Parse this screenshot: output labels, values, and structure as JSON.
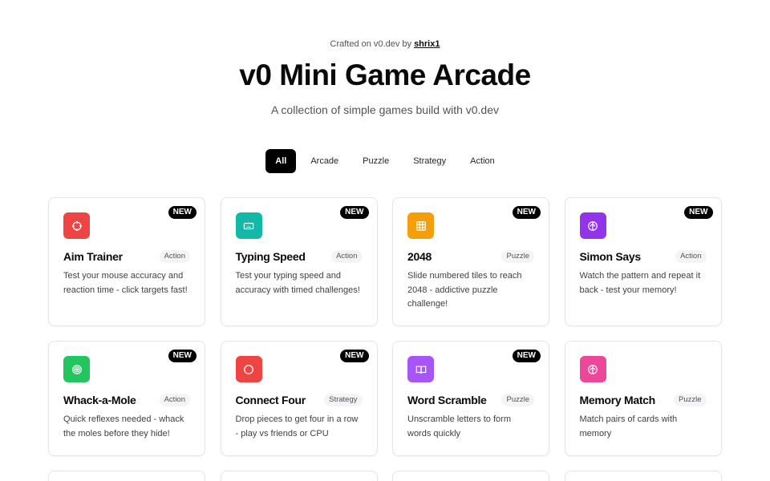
{
  "header": {
    "crafted_prefix": "Crafted on v0.dev by ",
    "author": "shrix1",
    "title": "v0 Mini Game Arcade",
    "subtitle": "A collection of simple games build with v0.dev"
  },
  "filters": [
    {
      "label": "All",
      "active": true
    },
    {
      "label": "Arcade",
      "active": false
    },
    {
      "label": "Puzzle",
      "active": false
    },
    {
      "label": "Strategy",
      "active": false
    },
    {
      "label": "Action",
      "active": false
    }
  ],
  "games": [
    {
      "name": "Aim Trainer",
      "category": "Action",
      "badge": "NEW",
      "color": "#ef4444",
      "icon": "target-icon",
      "description": "Test your mouse accuracy and reaction time - click targets fast!"
    },
    {
      "name": "Typing Speed",
      "category": "Action",
      "badge": "NEW",
      "color": "#14b8a6",
      "icon": "keyboard-icon",
      "description": "Test your typing speed and accuracy with timed challenges!"
    },
    {
      "name": "2048",
      "category": "Puzzle",
      "badge": "NEW",
      "color": "#f59e0b",
      "icon": "grid-icon",
      "description": "Slide numbered tiles to reach 2048 - addictive puzzle challenge!"
    },
    {
      "name": "Simon Says",
      "category": "Action",
      "badge": "NEW",
      "color": "#9333ea",
      "icon": "brain-icon",
      "description": "Watch the pattern and repeat it back - test your memory!"
    },
    {
      "name": "Whack-a-Mole",
      "category": "Action",
      "badge": "NEW",
      "color": "#22c55e",
      "icon": "bullseye-icon",
      "description": "Quick reflexes needed - whack the moles before they hide!"
    },
    {
      "name": "Connect Four",
      "category": "Strategy",
      "badge": "NEW",
      "color": "#ef4444",
      "icon": "circle-icon",
      "description": "Drop pieces to get four in a row - play vs friends or CPU"
    },
    {
      "name": "Word Scramble",
      "category": "Puzzle",
      "badge": "NEW",
      "color": "#a855f7",
      "icon": "book-icon",
      "description": "Unscramble letters to form words quickly"
    },
    {
      "name": "Memory Match",
      "category": "Puzzle",
      "badge": "",
      "color": "#ec4899",
      "icon": "brain-icon",
      "description": "Match pairs of cards with memory"
    }
  ]
}
